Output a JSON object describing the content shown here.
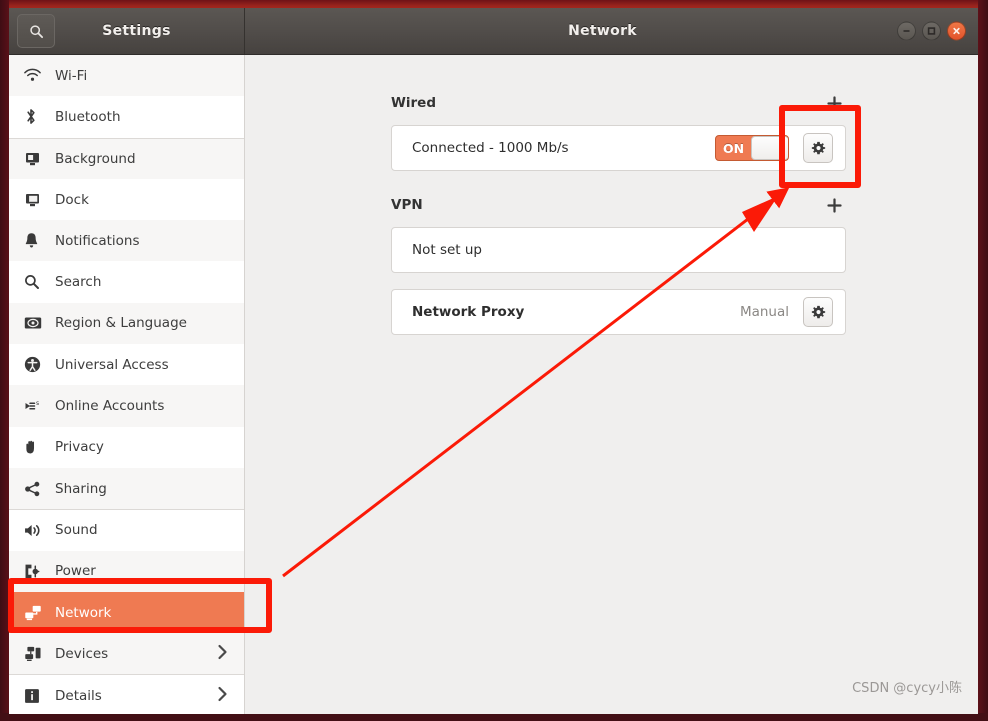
{
  "window": {
    "sidebar_title": "Settings",
    "content_title": "Network",
    "search_icon": "search-icon",
    "controls": [
      {
        "name": "minimize-button",
        "glyph": "minimize-icon"
      },
      {
        "name": "maximize-button",
        "glyph": "maximize-icon"
      },
      {
        "name": "close-button",
        "glyph": "close-icon",
        "color": "#e2532b"
      }
    ]
  },
  "sidebar": {
    "items": [
      {
        "label": "Wi-Fi",
        "icon": "wifi-icon",
        "selected": false,
        "chevron": false
      },
      {
        "label": "Bluetooth",
        "icon": "bluetooth-icon",
        "selected": false,
        "chevron": false
      },
      {
        "label": "Background",
        "icon": "background-icon",
        "selected": false,
        "chevron": false
      },
      {
        "label": "Dock",
        "icon": "dock-icon",
        "selected": false,
        "chevron": false
      },
      {
        "label": "Notifications",
        "icon": "bell-icon",
        "selected": false,
        "chevron": false
      },
      {
        "label": "Search",
        "icon": "search-icon",
        "selected": false,
        "chevron": false
      },
      {
        "label": "Region & Language",
        "icon": "region-language-icon",
        "selected": false,
        "chevron": false
      },
      {
        "label": "Universal Access",
        "icon": "universal-access-icon",
        "selected": false,
        "chevron": false
      },
      {
        "label": "Online Accounts",
        "icon": "online-accounts-icon",
        "selected": false,
        "chevron": false
      },
      {
        "label": "Privacy",
        "icon": "privacy-hand-icon",
        "selected": false,
        "chevron": false
      },
      {
        "label": "Sharing",
        "icon": "sharing-icon",
        "selected": false,
        "chevron": false
      },
      {
        "label": "Sound",
        "icon": "sound-icon",
        "selected": false,
        "chevron": false
      },
      {
        "label": "Power",
        "icon": "power-icon",
        "selected": false,
        "chevron": false
      },
      {
        "label": "Network",
        "icon": "network-icon",
        "selected": true,
        "chevron": false
      },
      {
        "label": "Devices",
        "icon": "devices-icon",
        "selected": false,
        "chevron": true
      },
      {
        "label": "Details",
        "icon": "details-info-icon",
        "selected": false,
        "chevron": true
      }
    ],
    "selected_color": "#ef7a52"
  },
  "content": {
    "wired": {
      "section_title": "Wired",
      "add_label": "+",
      "status": "Connected - 1000 Mb/s",
      "toggle_state": "ON",
      "settings_icon": "gear-icon"
    },
    "vpn": {
      "section_title": "VPN",
      "add_label": "+",
      "status": "Not set up"
    },
    "proxy": {
      "title": "Network Proxy",
      "value": "Manual",
      "settings_icon": "gear-icon"
    }
  },
  "annotations": {
    "highlight_color": "#fb1a07",
    "gear_box": "highlight-box-wired-gear",
    "network_box": "highlight-box-sidebar-network",
    "arrow": "pointer-arrow"
  },
  "watermark": "CSDN @cycy小陈"
}
